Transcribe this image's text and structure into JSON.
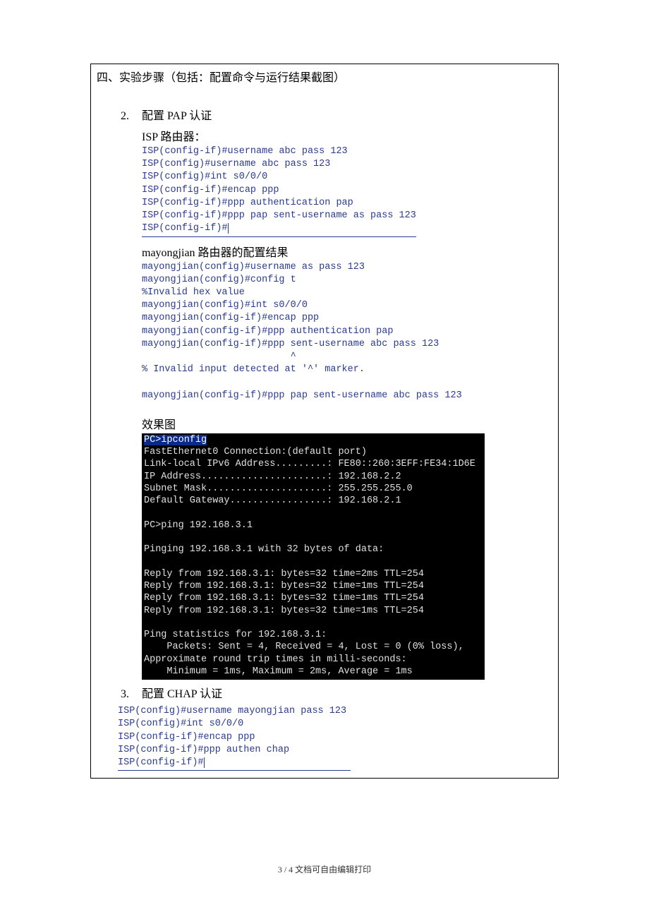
{
  "section_title": "四、实验步骤（包括：配置命令与运行结果截图）",
  "item2": {
    "num": "2.",
    "title": "配置 PAP 认证",
    "sub1_label": "ISP 路由器：",
    "cli1": "ISP(config-if)#username abc pass 123\nISP(config)#username abc pass 123\nISP(config)#int s0/0/0\nISP(config-if)#encap ppp\nISP(config-if)#ppp authentication pap\nISP(config-if)#ppp pap sent-username as pass 123\nISP(config-if)#",
    "sub2_label": "mayongjian 路由器的配置结果",
    "cli2": "mayongjian(config)#username as pass 123\nmayongjian(config)#config t\n%Invalid hex value\nmayongjian(config)#int s0/0/0\nmayongjian(config-if)#encap ppp\nmayongjian(config-if)#ppp authentication pap\nmayongjian(config-if)#ppp sent-username abc pass 123\n                          ^\n% Invalid input detected at '^' marker.\n\nmayongjian(config-if)#ppp pap sent-username abc pass 123",
    "result_label": "效果图",
    "term_first": "PC>ipconfig",
    "term_body": "\nFastEthernet0 Connection:(default port)\nLink-local IPv6 Address.........: FE80::260:3EFF:FE34:1D6E\nIP Address......................: 192.168.2.2\nSubnet Mask.....................: 255.255.255.0\nDefault Gateway.................: 192.168.2.1\n\nPC>ping 192.168.3.1\n\nPinging 192.168.3.1 with 32 bytes of data:\n\nReply from 192.168.3.1: bytes=32 time=2ms TTL=254\nReply from 192.168.3.1: bytes=32 time=1ms TTL=254\nReply from 192.168.3.1: bytes=32 time=1ms TTL=254\nReply from 192.168.3.1: bytes=32 time=1ms TTL=254\n\nPing statistics for 192.168.3.1:\n    Packets: Sent = 4, Received = 4, Lost = 0 (0% loss),\nApproximate round trip times in milli-seconds:\n    Minimum = 1ms, Maximum = 2ms, Average = 1ms"
  },
  "item3": {
    "num": "3.",
    "title": "配置 CHAP 认证",
    "cli": "ISP(config)#username mayongjian pass 123\nISP(config)#int s0/0/0\nISP(config-if)#encap ppp\nISP(config-if)#ppp authen chap\nISP(config-if)#"
  },
  "footer": "3 / 4 文档可自由编辑打印"
}
